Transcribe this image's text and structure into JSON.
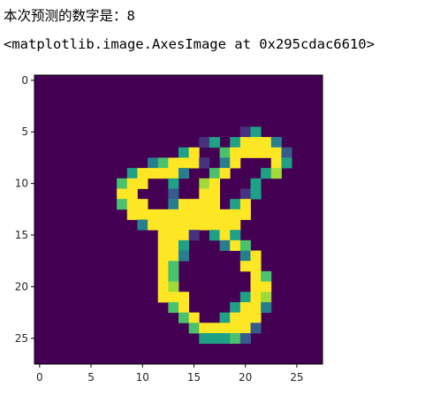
{
  "output": {
    "prediction_label": "本次预测的数字是：",
    "prediction_value": "8",
    "repr": "<matplotlib.image.AxesImage at 0x295cdac6610>"
  },
  "colors": {
    "background": "#440154",
    "palette": [
      "#440154",
      "#46327e",
      "#365c8d",
      "#277f8e",
      "#1fa187",
      "#4ac16d",
      "#a0da39",
      "#fde725"
    ]
  },
  "chart_data": {
    "type": "heatmap",
    "title": "",
    "xlabel": "",
    "ylabel": "",
    "shape": [
      28,
      28
    ],
    "colormap": "viridis",
    "xlim": [
      -0.5,
      27.5
    ],
    "ylim": [
      27.5,
      -0.5
    ],
    "x_ticks": [
      "0",
      "5",
      "10",
      "15",
      "20",
      "25"
    ],
    "y_ticks": [
      "0",
      "5",
      "10",
      "15",
      "20",
      "25"
    ],
    "grid": false,
    "rows": [
      "............................",
      "............................",
      "............................",
      "............................",
      "............................",
      "....................14......",
      "................14.47773.....",
      "..............47..5777772...",
      "...........357771.37...74...",
      ".........477773..57...46....",
      "........577..4..67...4......",
      "........77...2..77..14.......",
      "........577..37777.47.......",
      ".........777777777777.......",
      "..........3777777777........",
      "............7771.474........",
      "............774...375.......",
      "............773.....37......",
      "............75......77......",
      "............75.......75.....",
      "............76.......77.....",
      "............777.....476.....",
      ".............57....4773.....",
      "..............57..4777......",
      "...............5777772......",
      "................44452.......",
      "............................",
      "............................"
    ]
  }
}
